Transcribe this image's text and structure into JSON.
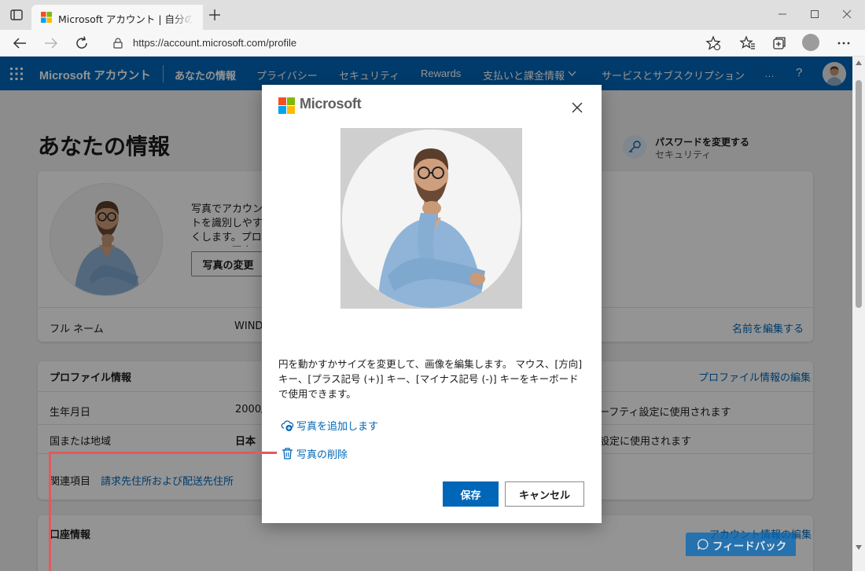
{
  "browser": {
    "tab_title": "Microsoft アカウント | 自分のプロフィール",
    "url": "https://account.microsoft.com/profile"
  },
  "header": {
    "brand": "Microsoft アカウント",
    "nav": [
      {
        "label": "あなたの情報"
      },
      {
        "label": "プライバシー"
      },
      {
        "label": "セキュリティ"
      },
      {
        "label": "Rewards"
      },
      {
        "label": "支払いと課金情報"
      },
      {
        "label": "サービスとサブスクリプション"
      },
      {
        "label": "…"
      },
      {
        "label": "?"
      }
    ]
  },
  "page": {
    "title": "あなたの情報",
    "password_link_title": "パスワードを変更する",
    "password_link_sub": "セキュリティ",
    "photo_desc": "写真でアカウントを識別しやすくします。プロフィール写真はMicrosoftのアプリとデバイスで表示されます。",
    "change_photo_label": "写真の変更",
    "fullname_label": "フル ネーム",
    "fullname_value": "WIND",
    "edit_name_link": "名前を編集する",
    "profile_info_title": "プロファイル情報",
    "edit_profile_link": "プロファイル情報の編集",
    "birthdate_label": "生年月日",
    "birthdate_value": "2000/",
    "birthdate_note": "ーフティ設定に使用されます",
    "country_label": "国または地域",
    "country_value": "日本",
    "country_note": "設定に使用されます",
    "related_label": "関連項目",
    "related_link": "請求先住所および配送先住所",
    "account_info_title": "口座情報",
    "edit_account_link": "アカウント情報の編集",
    "feedback_label": "フィードバック"
  },
  "dialog": {
    "brand": "Microsoft",
    "instructions": "円を動かすかサイズを変更して、画像を編集します。 マウス、[方向] キー、[プラス記号 (+)] キー、[マイナス記号 (-)] キーをキーボードで使用できます。",
    "add_photo_label": "写真を追加します",
    "delete_photo_label": "写真の削除",
    "save_label": "保存",
    "cancel_label": "キャンセル"
  },
  "colors": {
    "accent": "#0067b8",
    "callout": "#e15a5a"
  }
}
